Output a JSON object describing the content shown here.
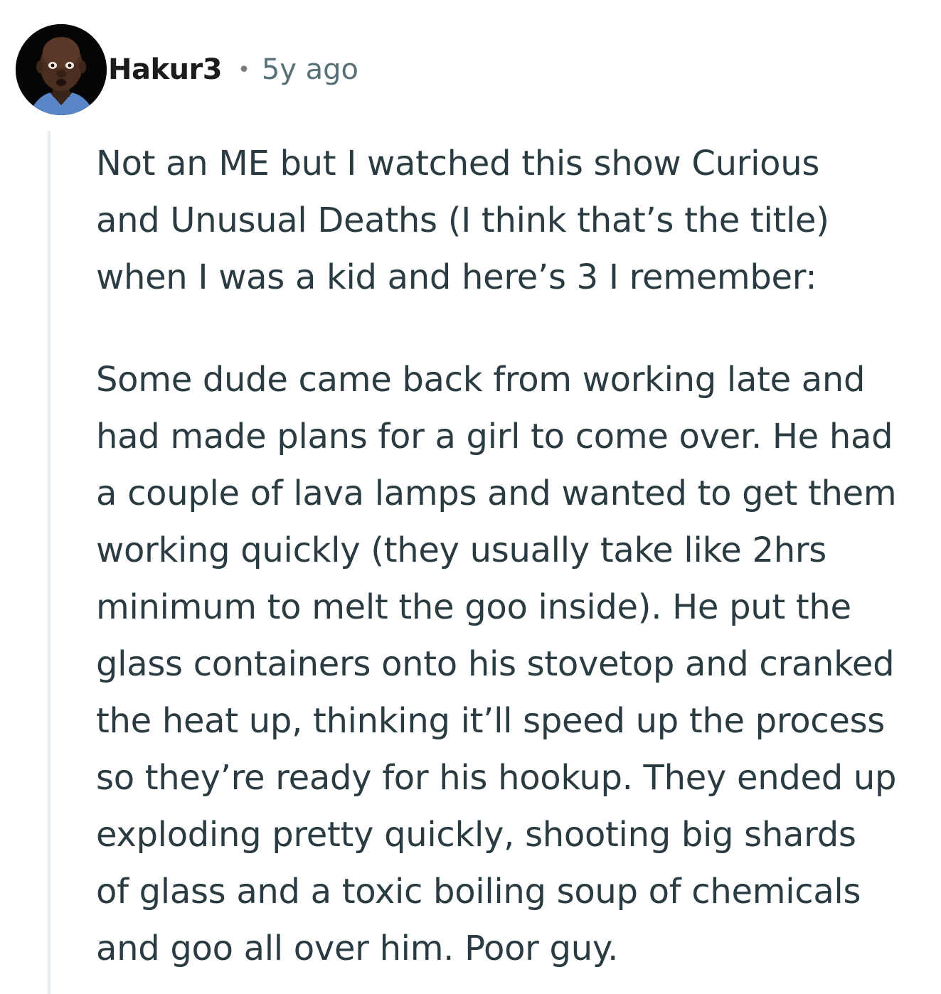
{
  "comment": {
    "author": "Hakur3",
    "separator": "•",
    "timestamp": "5y ago",
    "paragraphs": [
      "Not an ME but I watched this show Curious\nand Unusual Deaths (I think that’s the title)\nwhen I was a kid and here’s 3 I remember:",
      "Some dude came back from working late and\nhad made plans for a girl to come over. He had\na couple of lava lamps and wanted to get them\nworking quickly (they usually take like 2hrs\nminimum to melt the goo inside). He put the\nglass containers onto his stovetop and cranked\nthe heat up, thinking it’ll speed up the process\nso they’re ready for his hookup. They ended up\nexploding pretty quickly, shooting big shards\nof glass and a toxic boiling soup of chemicals\nand goo all over him. Poor guy."
    ]
  },
  "colors": {
    "text": "#2a3c42",
    "meta": "#576f76",
    "thread_line": "#e5ebee"
  }
}
